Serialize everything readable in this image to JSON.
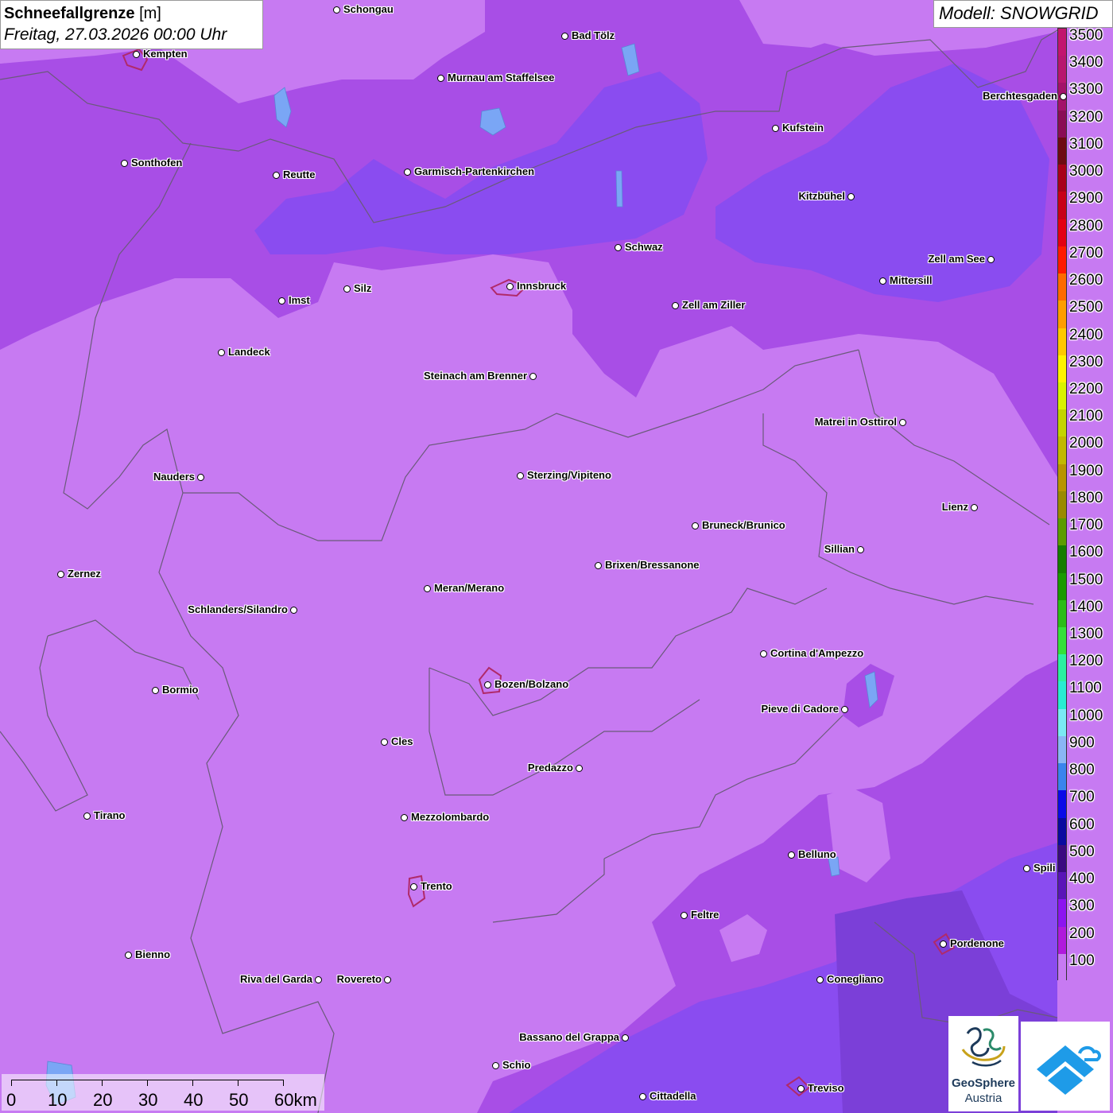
{
  "header": {
    "title_bold": "Schneefallgrenze",
    "title_unit": "[m]",
    "subtitle": "Freitag, 27.03.2026 00:00 Uhr",
    "model": "Modell: SNOWGRID"
  },
  "colors": {
    "background_low": "#c77af2",
    "mid_purple": "#a84ee6",
    "blue_purple": "#8a4cf0",
    "deep_violet": "#7b3fd8",
    "border_line": "#6a5a7a",
    "lakes": "#7aa6f5",
    "city_outline": "#b02a6a"
  },
  "legend": {
    "levels": [
      {
        "label": "3500",
        "color": "#c2156e"
      },
      {
        "label": "3400",
        "color": "#b8166f"
      },
      {
        "label": "3300",
        "color": "#a3126a"
      },
      {
        "label": "3200",
        "color": "#8a0d55"
      },
      {
        "label": "3100",
        "color": "#6e0a14"
      },
      {
        "label": "3000",
        "color": "#a8001a"
      },
      {
        "label": "2900",
        "color": "#c80018"
      },
      {
        "label": "2800",
        "color": "#e40012"
      },
      {
        "label": "2700",
        "color": "#ff1a00"
      },
      {
        "label": "2600",
        "color": "#ff6a00"
      },
      {
        "label": "2500",
        "color": "#ff9d00"
      },
      {
        "label": "2400",
        "color": "#ffc800"
      },
      {
        "label": "2300",
        "color": "#fff200"
      },
      {
        "label": "2200",
        "color": "#d9f200"
      },
      {
        "label": "2100",
        "color": "#c4d400"
      },
      {
        "label": "2000",
        "color": "#c2b800"
      },
      {
        "label": "1900",
        "color": "#b89400"
      },
      {
        "label": "1800",
        "color": "#9a8a00"
      },
      {
        "label": "1700",
        "color": "#5c9c00"
      },
      {
        "label": "1600",
        "color": "#167d00"
      },
      {
        "label": "1500",
        "color": "#1a9a00"
      },
      {
        "label": "1400",
        "color": "#2bbd18"
      },
      {
        "label": "1300",
        "color": "#35e03a"
      },
      {
        "label": "1200",
        "color": "#2cf0a0"
      },
      {
        "label": "1100",
        "color": "#28ecd2"
      },
      {
        "label": "1000",
        "color": "#7aeaf4"
      },
      {
        "label": "900",
        "color": "#8ab6f5"
      },
      {
        "label": "800",
        "color": "#3a84ee"
      },
      {
        "label": "700",
        "color": "#0a0ae8"
      },
      {
        "label": "600",
        "color": "#0a0aa0"
      },
      {
        "label": "500",
        "color": "#3a0a80"
      },
      {
        "label": "400",
        "color": "#5a14b8"
      },
      {
        "label": "300",
        "color": "#8c14f0"
      },
      {
        "label": "200",
        "color": "#b01adc"
      },
      {
        "label": "100",
        "color": "#c77af2"
      }
    ]
  },
  "cities": [
    {
      "name": "Schongau",
      "side": "right"
    },
    {
      "name": "Bad Tölz",
      "side": "right"
    },
    {
      "name": "Kempten",
      "side": "right"
    },
    {
      "name": "Murnau am Staffelsee",
      "side": "right"
    },
    {
      "name": "Berchtesgaden",
      "side": "left"
    },
    {
      "name": "Kufstein",
      "side": "right"
    },
    {
      "name": "Sonthofen",
      "side": "right"
    },
    {
      "name": "Reutte",
      "side": "right"
    },
    {
      "name": "Garmisch-Partenkirchen",
      "side": "right"
    },
    {
      "name": "Kitzbühel",
      "side": "left"
    },
    {
      "name": "Schwaz",
      "side": "right"
    },
    {
      "name": "Zell am See",
      "side": "left"
    },
    {
      "name": "Innsbruck",
      "side": "right"
    },
    {
      "name": "Mittersill",
      "side": "right"
    },
    {
      "name": "Silz",
      "side": "right"
    },
    {
      "name": "Imst",
      "side": "right"
    },
    {
      "name": "Zell am Ziller",
      "side": "right"
    },
    {
      "name": "Landeck",
      "side": "right"
    },
    {
      "name": "Steinach am Brenner",
      "side": "left"
    },
    {
      "name": "Matrei in Osttirol",
      "side": "left"
    },
    {
      "name": "Nauders",
      "side": "left"
    },
    {
      "name": "Sterzing/Vipiteno",
      "side": "right"
    },
    {
      "name": "Lienz",
      "side": "left"
    },
    {
      "name": "Bruneck/Brunico",
      "side": "right"
    },
    {
      "name": "Sillian",
      "side": "left"
    },
    {
      "name": "Brixen/Bressanone",
      "side": "right"
    },
    {
      "name": "Zernez",
      "side": "right"
    },
    {
      "name": "Meran/Merano",
      "side": "right"
    },
    {
      "name": "Schlanders/Silandro",
      "side": "left"
    },
    {
      "name": "Cortina d'Ampezzo",
      "side": "right"
    },
    {
      "name": "Bozen/Bolzano",
      "side": "right"
    },
    {
      "name": "Bormio",
      "side": "right"
    },
    {
      "name": "Pieve di Cadore",
      "side": "left"
    },
    {
      "name": "Cles",
      "side": "right"
    },
    {
      "name": "Predazzo",
      "side": "left"
    },
    {
      "name": "Tirano",
      "side": "right"
    },
    {
      "name": "Mezzolombardo",
      "side": "right"
    },
    {
      "name": "Belluno",
      "side": "right"
    },
    {
      "name": "Spili",
      "side": "right"
    },
    {
      "name": "Trento",
      "side": "right"
    },
    {
      "name": "Feltre",
      "side": "right"
    },
    {
      "name": "Pordenone",
      "side": "right"
    },
    {
      "name": "Bienno",
      "side": "right"
    },
    {
      "name": "Riva del Garda",
      "side": "left"
    },
    {
      "name": "Rovereto",
      "side": "left"
    },
    {
      "name": "Conegliano",
      "side": "right"
    },
    {
      "name": "Bassano del Grappa",
      "side": "left"
    },
    {
      "name": "Schio",
      "side": "right"
    },
    {
      "name": "Treviso",
      "side": "right"
    },
    {
      "name": "Cittadella",
      "side": "right"
    }
  ],
  "scale_bar": {
    "labels": [
      "0",
      "10",
      "20",
      "30",
      "40",
      "50",
      "60km"
    ]
  },
  "logos": {
    "geosphere_line1": "GeoSphere",
    "geosphere_line2": "Austria",
    "geosphere_icon": "geosphere-swirl-icon",
    "partner_icon": "cloud-arrow-icon"
  }
}
